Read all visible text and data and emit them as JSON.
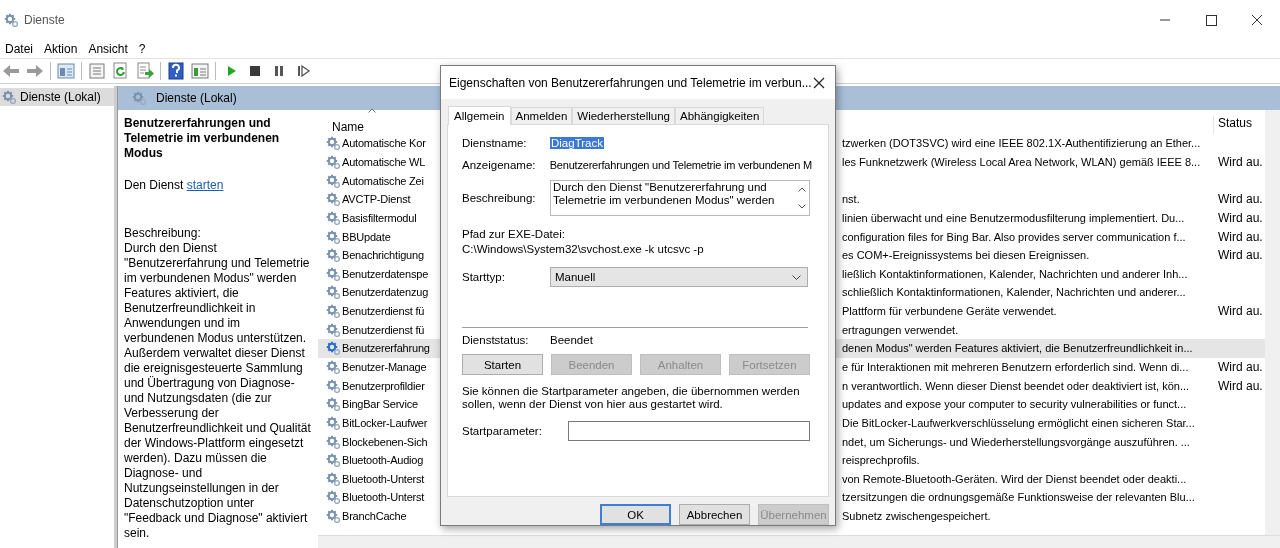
{
  "window": {
    "title": "Dienste"
  },
  "menu": [
    "Datei",
    "Aktion",
    "Ansicht",
    "?"
  ],
  "toolbar": [
    {
      "kind": "back"
    },
    {
      "kind": "forward"
    },
    {
      "kind": "sep"
    },
    {
      "kind": "tree"
    },
    {
      "kind": "sep"
    },
    {
      "kind": "properties"
    },
    {
      "kind": "refresh"
    },
    {
      "kind": "export"
    },
    {
      "kind": "sep"
    },
    {
      "kind": "help"
    },
    {
      "kind": "view"
    },
    {
      "kind": "sep"
    },
    {
      "kind": "play"
    },
    {
      "kind": "stop"
    },
    {
      "kind": "pause"
    },
    {
      "kind": "resume"
    }
  ],
  "tree": {
    "items": [
      {
        "label": "Dienste (Lokal)",
        "selected": true
      }
    ]
  },
  "pane": {
    "header": "Dienste (Lokal)",
    "service_title": "Benutzererfahrungen und Telemetrie im verbundenen Modus",
    "action_prefix": "Den Dienst",
    "action_link": "starten",
    "description_label": "Beschreibung:",
    "description": "Durch den Dienst \"Benutzererfahrung und Telemetrie im verbundenen Modus\" werden Features aktiviert, die Benutzerfreundlichkeit in Anwendungen und im verbundenen Modus unterstützen. Außerdem verwaltet dieser Dienst die ereignisgesteuerte Sammlung und Übertragung von Diagnose- und Nutzungsdaten (die zur Verbesserung der Benutzerfreundlichkeit und Qualität der Windows-Plattform eingesetzt werden). Dazu müssen die Diagnose- und Nutzungseinstellungen in der Datenschutzoption unter \"Feedback und Diagnose\" aktiviert sein."
  },
  "list": {
    "columns": [
      "Name",
      "Status"
    ],
    "rows": [
      {
        "name": "Automatische Kor",
        "desc": "tzwerken (DOT3SVC) wird eine IEEE 802.1X-Authentifizierung an Ether...",
        "selected": false
      },
      {
        "name": "Automatische WL",
        "desc": "les Funknetzwerk (Wireless Local Area Network, WLAN) gemäß IEEE 8...",
        "status": "Wird au.",
        "selected": false
      },
      {
        "name": "Automatische Zei",
        "selected": false
      },
      {
        "name": "AVCTP-Dienst",
        "desc": "nst.",
        "status": "Wird au.",
        "selected": false
      },
      {
        "name": "Basisfiltermodul",
        "desc": "linien überwacht und eine Benutzermodusfilterung implementiert. Du...",
        "status": "Wird au.",
        "selected": false
      },
      {
        "name": "BBUpdate",
        "desc": "configuration files for Bing Bar. Also provides server communication f...",
        "status": "Wird au.",
        "selected": false
      },
      {
        "name": "Benachrichtigung",
        "desc": "es COM+-Ereignissystems bei diesen Ereignissen.",
        "status": "Wird au.",
        "selected": false
      },
      {
        "name": "Benutzerdatenspe",
        "desc": "ließlich Kontaktinformationen, Kalender, Nachrichten und anderer Inh...",
        "selected": false
      },
      {
        "name": "Benutzerdatenzug",
        "desc": "schließlich Kontaktinformationen, Kalender, Nachrichten und anderer...",
        "selected": false
      },
      {
        "name": "Benutzerdienst fü",
        "desc": "Plattform für verbundene Geräte verwendet.",
        "status": "Wird au.",
        "selected": false
      },
      {
        "name": "Benutzerdienst fü",
        "desc": "ertragungen verwendet.",
        "selected": false
      },
      {
        "name": "Benutzererfahrung",
        "desc": "denen Modus\" werden Features aktiviert, die Benutzerfreundlichkeit in...",
        "selected": true
      },
      {
        "name": "Benutzer-Manage",
        "desc": "e für Interaktionen mit mehreren Benutzern erforderlich sind. Wenn di...",
        "status": "Wird au.",
        "selected": false
      },
      {
        "name": "Benutzerprofildier",
        "desc": "n verantwortlich. Wenn dieser Dienst beendet oder deaktiviert ist, kön...",
        "status": "Wird au.",
        "selected": false
      },
      {
        "name": "BingBar Service",
        "desc": "updates and expose your computer to security vulnerabilities or funct...",
        "selected": false
      },
      {
        "name": "BitLocker-Laufwer",
        "desc": "Die BitLocker-Laufwerkverschlüsselung ermöglicht einen sicheren Star...",
        "selected": false
      },
      {
        "name": "Blockebenen-Sich",
        "desc": "ndet, um Sicherungs- und Wiederherstellungsvorgänge auszuführen. ...",
        "selected": false
      },
      {
        "name": "Bluetooth-Audiog",
        "desc": "reisprechprofils.",
        "selected": false
      },
      {
        "name": "Bluetooth-Unterst",
        "desc": "von Remote-Bluetooth-Geräten. Wird der Dienst beendet oder deakti...",
        "selected": false
      },
      {
        "name": "Bluetooth-Unterst",
        "desc": "tzersitzungen die ordnungsgemäße Funktionsweise der relevanten Blu...",
        "selected": false
      },
      {
        "name": "BranchCache",
        "desc": "Subnetz zwischengespeichert.",
        "selected": false
      }
    ]
  },
  "dialog": {
    "title": "Eigenschaften von Benutzererfahrungen und Telemetrie im verbun...",
    "tabs": [
      {
        "label": "Allgemein",
        "selected": true
      },
      {
        "label": "Anmelden",
        "selected": false
      },
      {
        "label": "Wiederherstellung",
        "selected": false
      },
      {
        "label": "Abhängigkeiten",
        "selected": false
      }
    ],
    "service_name": {
      "label": "Dienstname:",
      "value": "DiagTrack",
      "selected": true
    },
    "display_name": {
      "label": "Anzeigename:",
      "value": "Benutzererfahrungen und Telemetrie im verbundenen M"
    },
    "description": {
      "label": "Beschreibung:",
      "value": "Durch den Dienst \"Benutzererfahrung und Telemetrie im verbundenen Modus\" werden"
    },
    "exe_path": {
      "label": "Pfad zur EXE-Datei:",
      "value": "C:\\Windows\\System32\\svchost.exe -k utcsvc -p"
    },
    "startup_type": {
      "label": "Starttyp:",
      "value": "Manuell"
    },
    "status": {
      "label": "Dienststatus:",
      "value": "Beendet"
    },
    "service_buttons": [
      {
        "label": "Starten",
        "disabled": false
      },
      {
        "label": "Beenden",
        "disabled": true
      },
      {
        "label": "Anhalten",
        "disabled": true
      },
      {
        "label": "Fortsetzen",
        "disabled": true
      }
    ],
    "note": "Sie können die Startparameter angeben, die übernommen werden sollen, wenn der Dienst von hier aus gestartet wird.",
    "start_params": {
      "label": "Startparameter:"
    },
    "buttons": [
      {
        "label": "OK",
        "disabled": false,
        "default": true
      },
      {
        "label": "Abbrechen",
        "disabled": false,
        "default": false
      },
      {
        "label": "Übernehmen",
        "disabled": true,
        "default": false
      }
    ]
  }
}
